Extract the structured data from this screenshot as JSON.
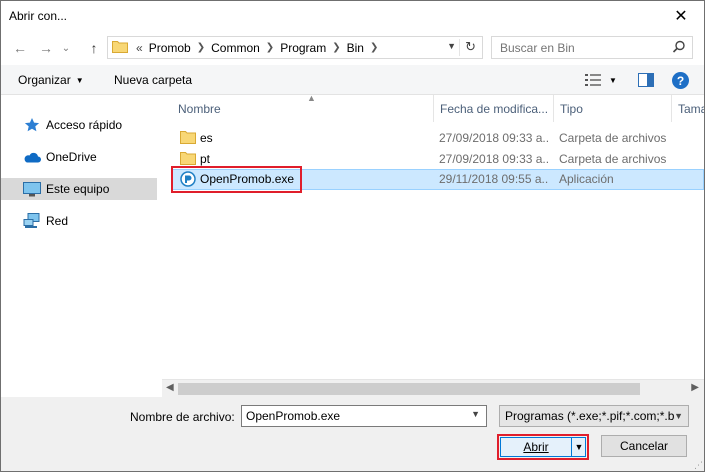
{
  "window": {
    "title": "Abrir con...",
    "close_glyph": "✕"
  },
  "nav": {
    "back_glyph": "←",
    "forward_glyph": "→",
    "recent_glyph": "⌄",
    "up_glyph": "↑",
    "address_prefix": "«",
    "breadcrumbs": [
      {
        "label": "Promob"
      },
      {
        "label": "Common"
      },
      {
        "label": "Program"
      },
      {
        "label": "Bin"
      }
    ],
    "refresh_glyph": "↻",
    "search_placeholder": "Buscar en Bin"
  },
  "toolbar": {
    "organize_label": "Organizar",
    "new_folder_label": "Nueva carpeta",
    "help_label": "?"
  },
  "sidebar": {
    "items": [
      {
        "label": "Acceso rápido",
        "icon": "star-icon",
        "selected": false
      },
      {
        "label": "OneDrive",
        "icon": "cloud-icon",
        "selected": false
      },
      {
        "label": "Este equipo",
        "icon": "computer-icon",
        "selected": true
      },
      {
        "label": "Red",
        "icon": "network-icon",
        "selected": false
      }
    ]
  },
  "filelist": {
    "columns": [
      {
        "label": "Nombre"
      },
      {
        "label": "Fecha de modifica..."
      },
      {
        "label": "Tipo"
      },
      {
        "label": "Tama"
      }
    ],
    "rows": [
      {
        "name": "es",
        "date": "27/09/2018 09:33 a...",
        "type": "Carpeta de archivos",
        "icon": "folder-icon",
        "selected": false
      },
      {
        "name": "pt",
        "date": "27/09/2018 09:33 a...",
        "type": "Carpeta de archivos",
        "icon": "folder-icon",
        "selected": false
      },
      {
        "name": "OpenPromob.exe",
        "date": "29/11/2018 09:55 a...",
        "type": "Aplicación",
        "icon": "app-icon",
        "selected": true
      }
    ]
  },
  "bottom": {
    "filename_label": "Nombre de archivo:",
    "filename_value": "OpenPromob.exe",
    "filter_value": "Programas (*.exe;*.pif;*.com;*.bat;*.cmd)",
    "open_label": "Abrir",
    "cancel_label": "Cancelar"
  },
  "colors": {
    "selection_bg": "#cce8ff",
    "selection_border": "#99d1ff",
    "highlight_red": "#e01e2b",
    "accent_blue": "#0078d7"
  }
}
